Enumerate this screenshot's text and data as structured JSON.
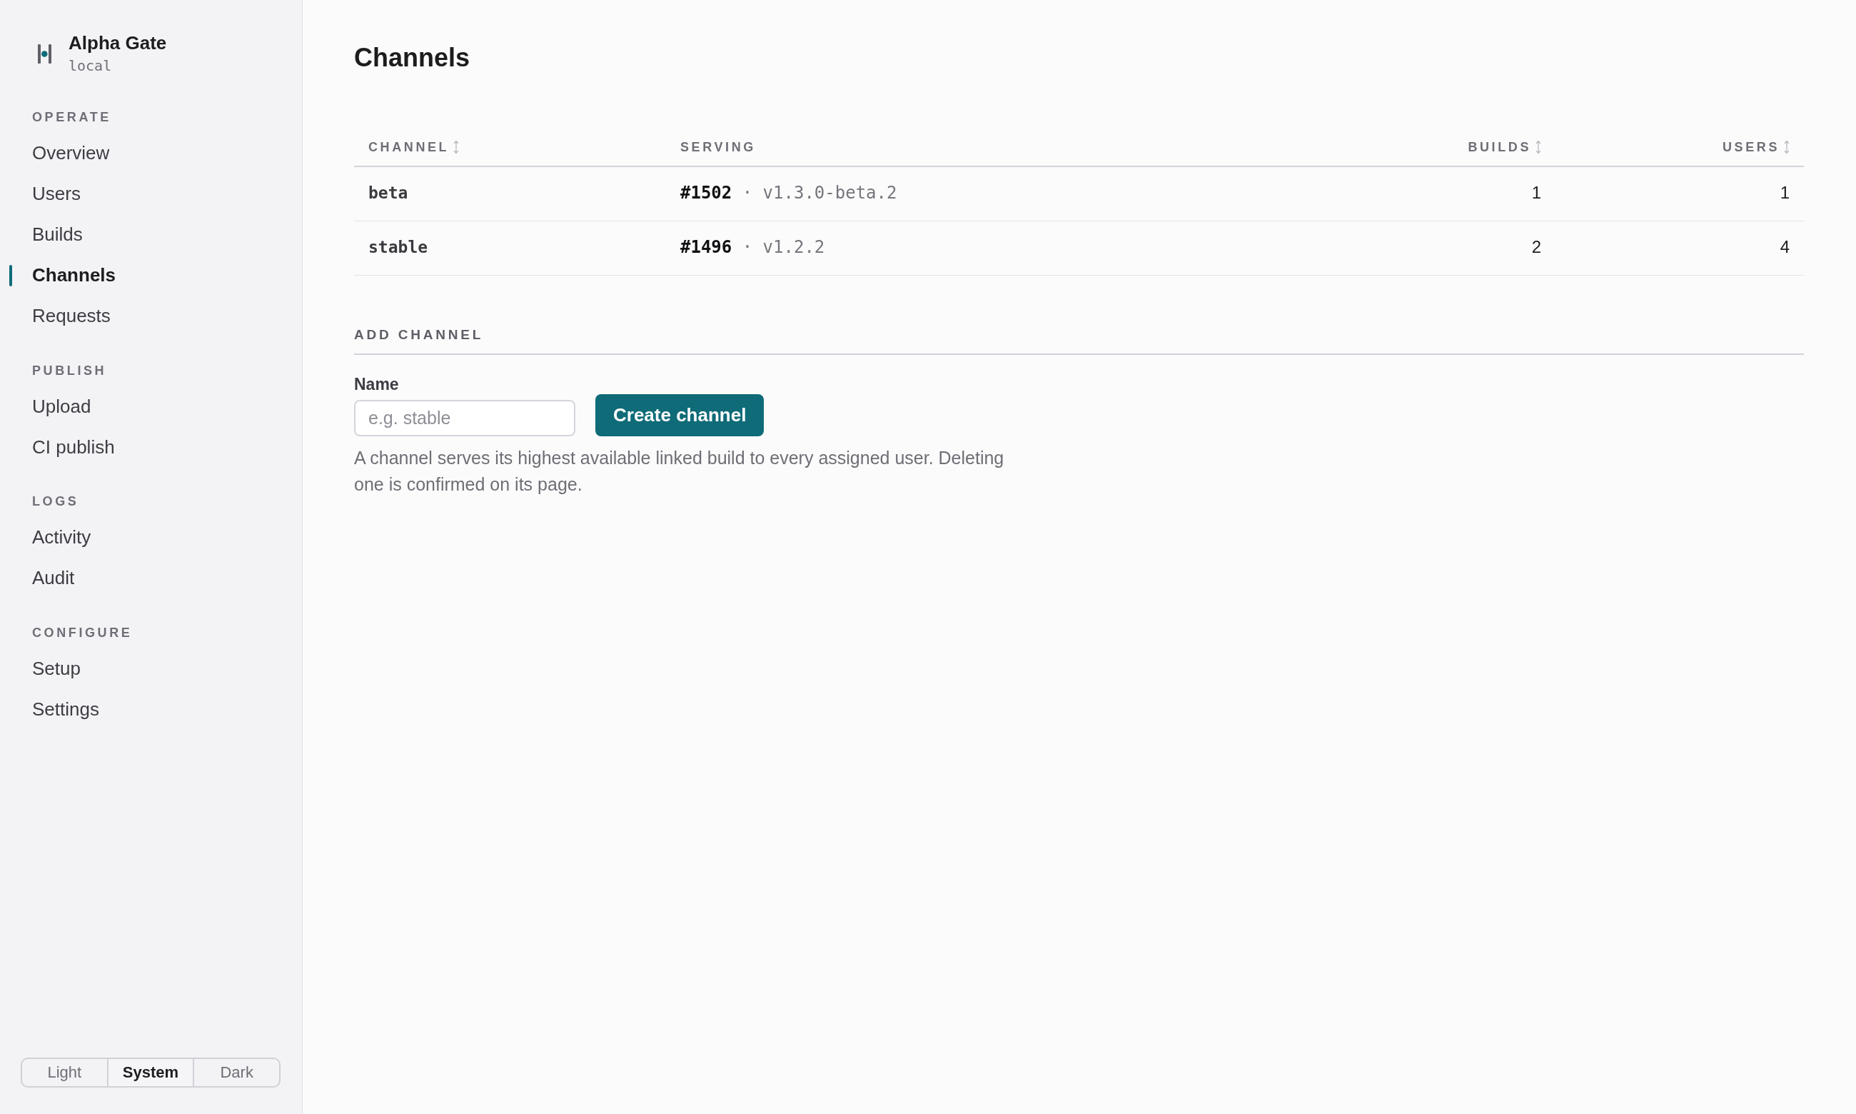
{
  "sidebar": {
    "brand": {
      "name": "Alpha Gate",
      "subtitle": "local"
    },
    "sections": [
      {
        "heading": "OPERATE",
        "items": [
          {
            "label": "Overview",
            "selected": false
          },
          {
            "label": "Users",
            "selected": false
          },
          {
            "label": "Builds",
            "selected": false
          },
          {
            "label": "Channels",
            "selected": true
          },
          {
            "label": "Requests",
            "selected": false
          }
        ]
      },
      {
        "heading": "PUBLISH",
        "items": [
          {
            "label": "Upload",
            "selected": false
          },
          {
            "label": "CI publish",
            "selected": false
          }
        ]
      },
      {
        "heading": "LOGS",
        "items": [
          {
            "label": "Activity",
            "selected": false
          },
          {
            "label": "Audit",
            "selected": false
          }
        ]
      },
      {
        "heading": "CONFIGURE",
        "items": [
          {
            "label": "Setup",
            "selected": false
          },
          {
            "label": "Settings",
            "selected": false
          }
        ]
      }
    ],
    "theme_switcher": [
      {
        "label": "Light",
        "selected": false
      },
      {
        "label": "System",
        "selected": true
      },
      {
        "label": "Dark",
        "selected": false
      }
    ]
  },
  "page": {
    "title": "Channels"
  },
  "table": {
    "columns": [
      {
        "label": "CHANNEL",
        "kind": "name",
        "sortable": true
      },
      {
        "label": "SERVING",
        "kind": "build",
        "sortable": false
      },
      {
        "label": "BUILDS",
        "kind": "count",
        "sortable": true
      },
      {
        "label": "USERS",
        "kind": "count",
        "sortable": true
      }
    ],
    "rows": [
      {
        "cells": [
          "beta",
          "**#1502** · v1.3.0-beta.2",
          "1",
          "1"
        ]
      },
      {
        "cells": [
          "stable",
          "**#1496** · v1.2.2",
          "2",
          "4"
        ]
      }
    ]
  },
  "add_channel": {
    "heading": "ADD CHANNEL",
    "field": {
      "label": "Name",
      "placeholder": "e.g. stable"
    },
    "button": "Create channel",
    "help": "A channel serves its highest available linked build to every assigned user. Deleting one is confirmed on its page."
  }
}
